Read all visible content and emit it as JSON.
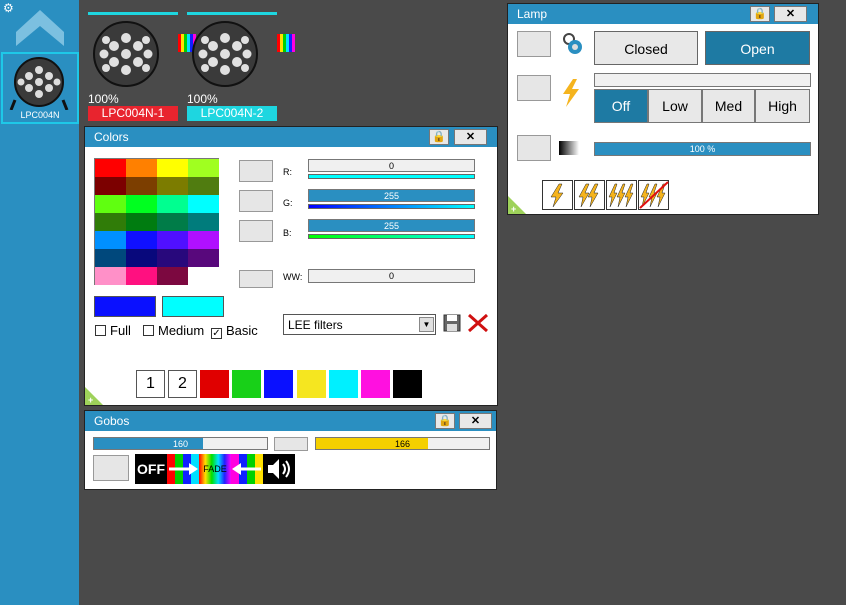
{
  "sidebar": {
    "fixture_label": "LPC004N"
  },
  "fixtures": [
    {
      "percent": "100%",
      "name": "LPC004N-1",
      "color": "#e8242e"
    },
    {
      "percent": "100%",
      "name": "LPC004N-2",
      "color": "#1ed6e0"
    }
  ],
  "lamp": {
    "title": "Lamp",
    "closed_label": "Closed",
    "open_label": "Open",
    "power_levels": [
      "Off",
      "Low",
      "Med",
      "High"
    ],
    "power_selected": "Off",
    "dimmer_value": "100 %",
    "dimmer_fraction": 1.0
  },
  "colors": {
    "title": "Colors",
    "r_label": "R:",
    "g_label": "G:",
    "b_label": "B:",
    "ww_label": "WW:",
    "r_value": "0",
    "g_value": "255",
    "b_value": "255",
    "ww_value": "0",
    "filter_full": "Full",
    "filter_medium": "Medium",
    "filter_basic": "Basic",
    "basic_checked": "✓",
    "filter_select": "LEE filters",
    "preset_1": "1",
    "preset_2": "2",
    "current_color": "#0a10ff",
    "target_color": "#00ffff",
    "preset_colors": [
      "#e00000",
      "#18d018",
      "#0a10ff",
      "#f5e620",
      "#00f0ff",
      "#ff10e0",
      "#000000"
    ]
  },
  "gobos": {
    "title": "Gobos",
    "slider1_value": "160",
    "slider1_fraction": 0.63,
    "slider2_value": "166",
    "slider2_fraction": 0.65,
    "off_label": "OFF",
    "fade_label": "FADE"
  },
  "accent": "#2a8fc1"
}
